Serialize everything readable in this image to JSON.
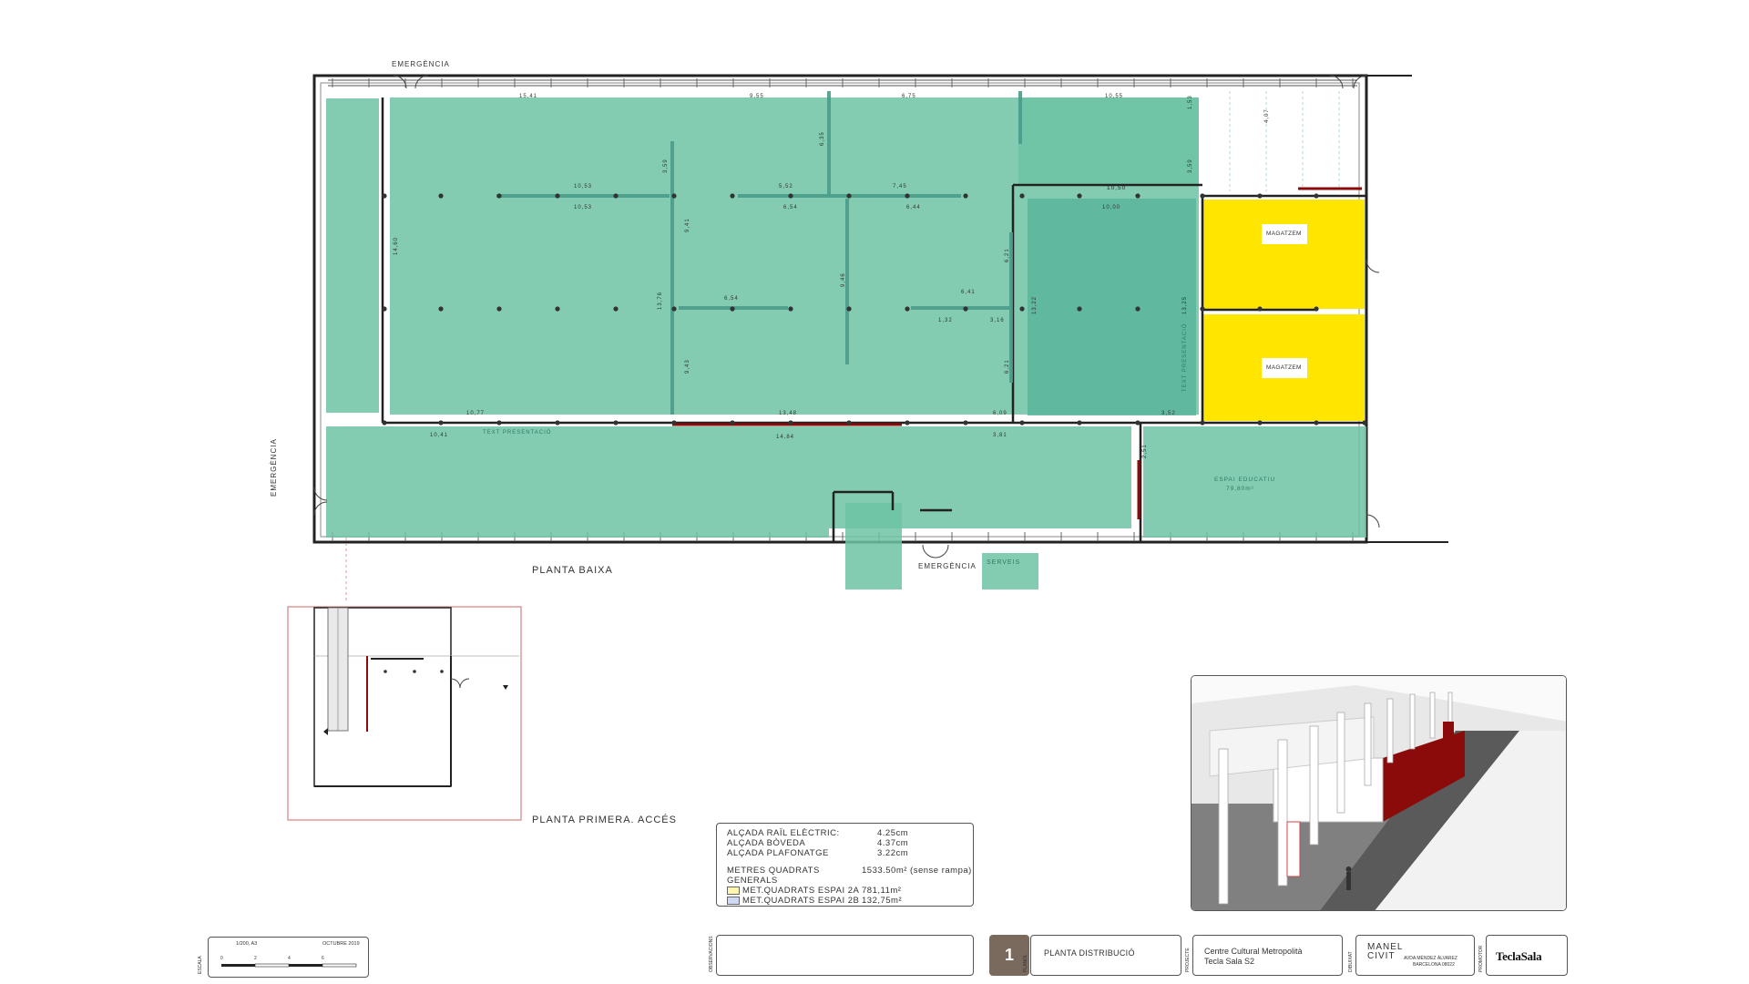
{
  "labels": {
    "emergencia": "EMERGÈNCIA",
    "planta_baixa": "PLANTA BAIXA",
    "planta_primera": "PLANTA PRIMERA. ACCÉS",
    "magatzem": "MAGATZEM",
    "serveis": "SERVEIS",
    "espai_educatiu": "ESPAI EDUCATIU",
    "espai_educatiu_area": "79,80m²",
    "text_presentacio": "TEXT PRESENTACIÓ"
  },
  "dimensions": {
    "top": [
      "15,41",
      "9,55",
      "6,75",
      "10,55"
    ],
    "row1": [
      "10,53",
      "5,52",
      "7,45",
      "10,50"
    ],
    "row1b": [
      "10,53",
      "6,54",
      "6,44",
      "10,00"
    ],
    "mid": [
      "6,54",
      "6,41",
      "1,32",
      "3,16"
    ],
    "bottom": [
      "10,77",
      "13,48",
      "6,09",
      "3,52"
    ],
    "bottom2": [
      "10,41",
      "14,84",
      "3,81"
    ],
    "vertical": [
      "14,60",
      "3,59",
      "9,41",
      "13,76",
      "9,43",
      "9,46",
      "6,35",
      "6,21",
      "6,21",
      "13,22",
      "13,25",
      "2,51",
      "1,53",
      "3,59",
      "4,07"
    ]
  },
  "legend": {
    "rows": [
      {
        "key": "ALÇADA RAÏL ELÈCTRIC:",
        "value": "4.25cm"
      },
      {
        "key": "ALÇADA BÒVEDA",
        "value": "4.37cm"
      },
      {
        "key": "ALÇADA PLAFONATGE",
        "value": "3.22cm"
      }
    ],
    "general_key": "METRES QUADRATS GENERALS",
    "general_value": "1533.50m² (sense rampa)",
    "espai_2a_key": "MET.QUADRATS ESPAI 2A",
    "espai_2a_value": "781,11m²",
    "espai_2b_key": "MET.QUADRATS ESPAI 2B",
    "espai_2b_value": "132,75m²"
  },
  "title_block": {
    "scale": "1/200, A3",
    "date": "OCTUBRE 2019",
    "scale_label": "ESCALA",
    "scale_ticks": [
      "0",
      "2",
      "4",
      "6"
    ],
    "sheet_number": "1",
    "sheet_title": "PLANTA DISTRIBUCIÓ",
    "project_line1": "Centre Cultural Metropolità",
    "project_line2": "Tecla Sala S2",
    "logo_text": "MANEL CIVIT",
    "logo_sub1": "AVDA MÈNDEZ ÀLVAREZ",
    "logo_sub2": "BARCELONA 08022",
    "brand": "TeclaSala",
    "side_label_obs": "OBSERVACIONS",
    "side_label_plan": "PLÀNOL",
    "side_label_proj": "PROJECTE",
    "side_label_dib": "DIBUIXAT",
    "side_label_prom": "PROMOTOR"
  },
  "colors": {
    "teal": "#6dc3a4",
    "teal_dark": "#5bb49b",
    "yellow": "#ffe600",
    "wall": "#222222",
    "red": "#8b0a0a",
    "border_red": "#d98080"
  }
}
